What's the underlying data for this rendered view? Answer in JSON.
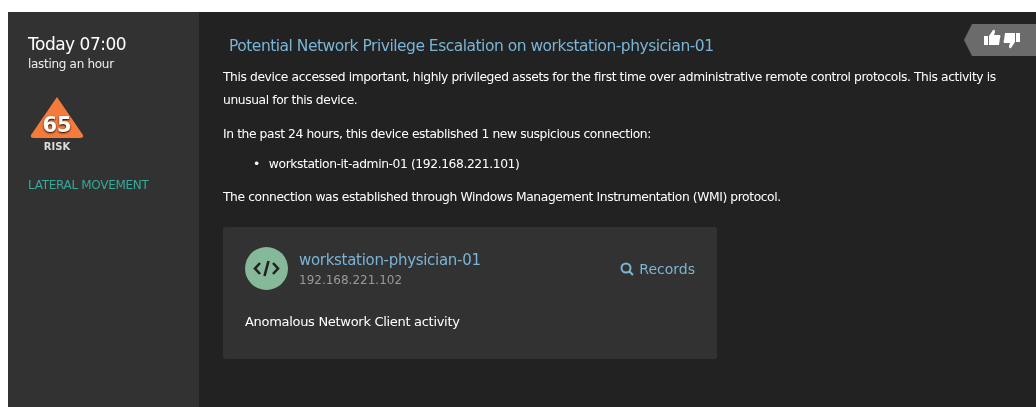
{
  "sidebar": {
    "time": "Today 07:00",
    "duration": "lasting an hour",
    "risk": {
      "score": "65",
      "label": "RISK"
    },
    "category": "LATERAL MOVEMENT"
  },
  "alert": {
    "title": "Potential Network Privilege Escalation on workstation-physician-01",
    "paragraphs": [
      "This device accessed important, highly privileged assets for the first time over administrative remote control protocols. This activity is unusual for this device.",
      "In the past 24 hours, this device established 1 new suspicious connection:"
    ],
    "connections": [
      {
        "bullet": "•",
        "text": "workstation-it-admin-01 (192.168.221.101)"
      }
    ],
    "footer": "The connection was established through Windows Management Instrumentation (WMI) protocol.",
    "device": {
      "name": "workstation-physician-01",
      "ip": "192.168.221.102",
      "records_label": "Records",
      "activity": "Anomalous Network Client activity"
    }
  }
}
